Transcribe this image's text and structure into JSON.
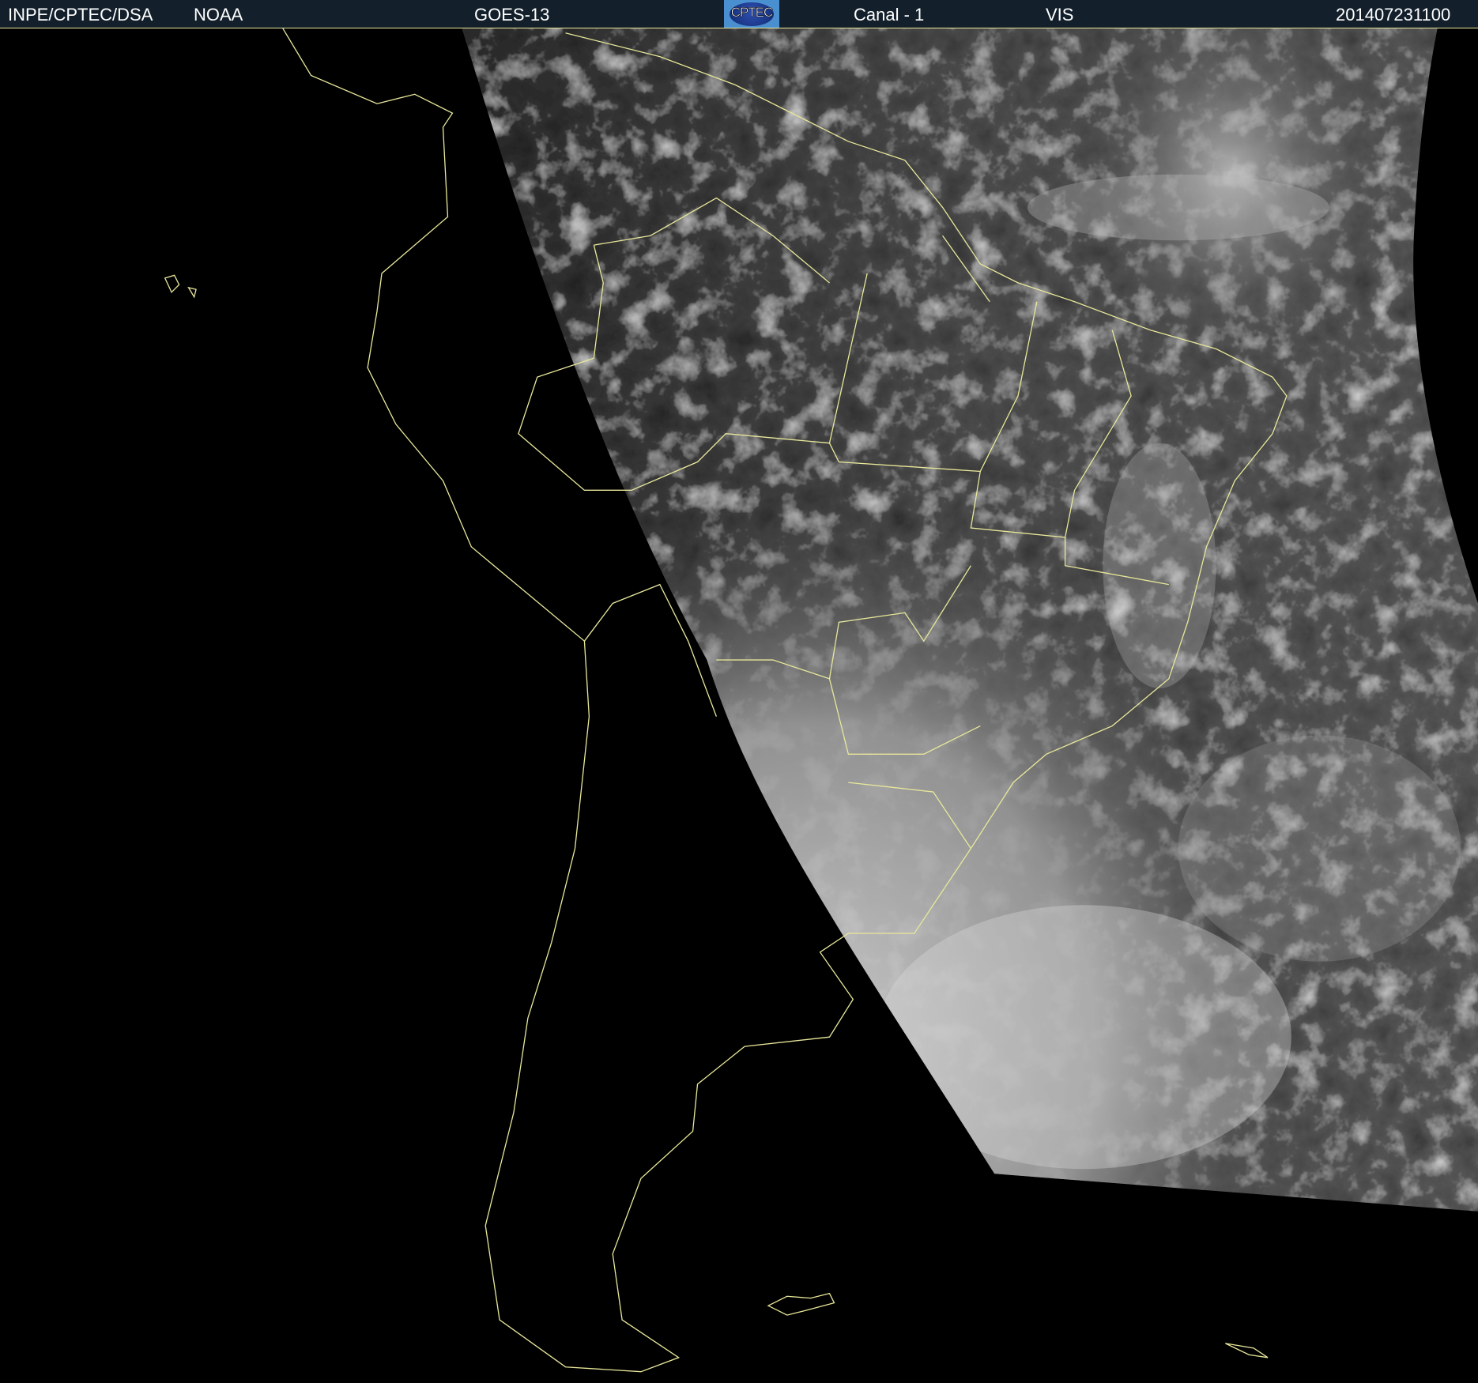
{
  "header": {
    "institution": "INPE/CPTEC/DSA",
    "agency": "NOAA",
    "satellite": "GOES-13",
    "logo_text": "CPTEC",
    "channel": "Canal - 1",
    "band": "VIS",
    "timestamp": "201407231100"
  },
  "colors": {
    "header_bg": "#13202b",
    "coastline": "#e8e79a",
    "background": "#000000"
  }
}
